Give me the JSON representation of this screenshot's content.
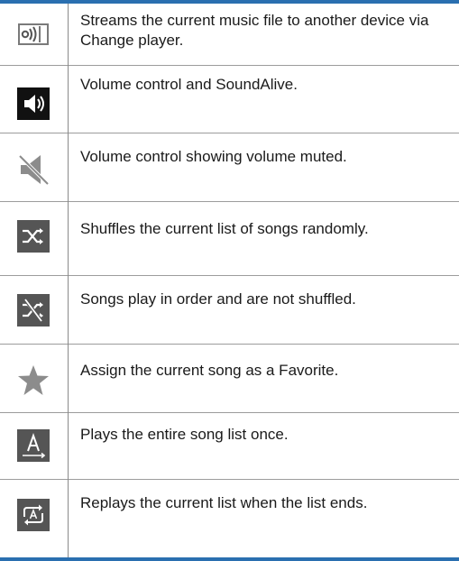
{
  "rows": [
    {
      "icon": "change-player-icon",
      "text": "Streams the current music file to another device via Change player."
    },
    {
      "icon": "volume-icon",
      "text": "Volume control and SoundAlive."
    },
    {
      "icon": "volume-muted-icon",
      "text": "Volume control showing volume muted."
    },
    {
      "icon": "shuffle-on-icon",
      "text": "Shuffles the current list of songs randomly."
    },
    {
      "icon": "shuffle-off-icon",
      "text": "Songs play in order and are not shuffled."
    },
    {
      "icon": "favorite-star-icon",
      "text": "Assign the current song as a Favorite."
    },
    {
      "icon": "play-once-icon",
      "text": "Plays the entire song list once."
    },
    {
      "icon": "repeat-all-icon",
      "text": "Replays the current list when the list ends."
    }
  ],
  "colors": {
    "accent": "#2a6fb0",
    "icon_dark": "#555555",
    "icon_black": "#111111",
    "icon_gray": "#8c8c8c"
  }
}
